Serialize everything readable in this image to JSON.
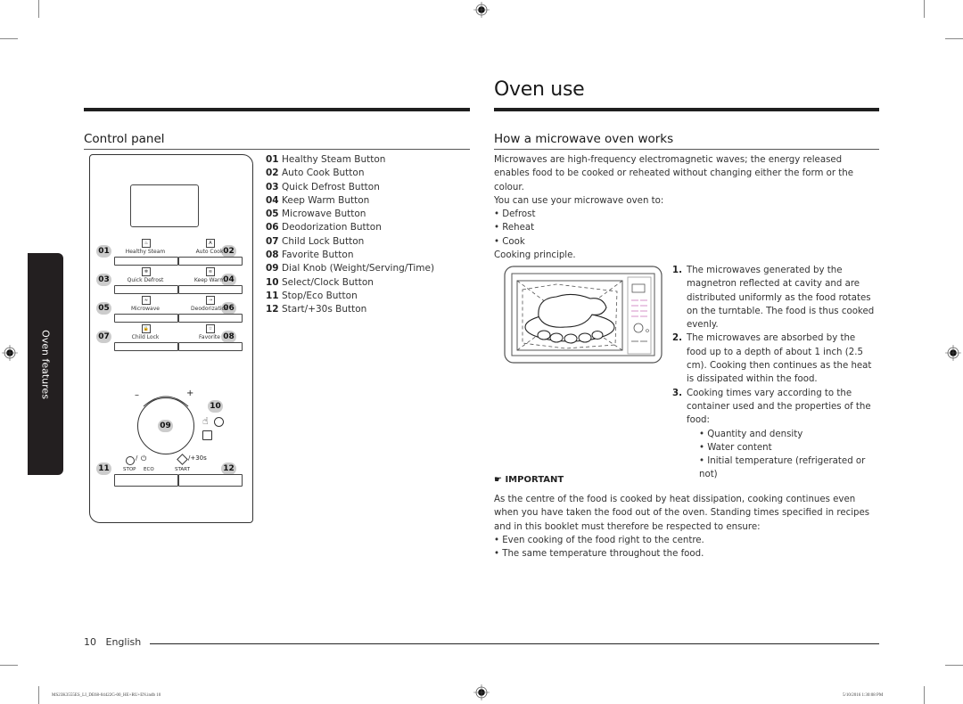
{
  "page": {
    "title": "Oven use",
    "side_tab": "Oven features",
    "footer": {
      "page_number": "10",
      "language": "English"
    },
    "print_info": {
      "file": "MS23K3555ES_LI_DE68-04422G-00_HE+RU+EN.indb   10",
      "timestamp": "5/10/2016   1:30:08 PM"
    }
  },
  "control_panel": {
    "heading": "Control panel",
    "legend": [
      {
        "num": "01",
        "label": "Healthy Steam Button"
      },
      {
        "num": "02",
        "label": "Auto Cook Button"
      },
      {
        "num": "03",
        "label": "Quick Defrost Button"
      },
      {
        "num": "04",
        "label": "Keep Warm Button"
      },
      {
        "num": "05",
        "label": "Microwave Button"
      },
      {
        "num": "06",
        "label": "Deodorization Button"
      },
      {
        "num": "07",
        "label": "Child Lock Button"
      },
      {
        "num": "08",
        "label": "Favorite Button"
      },
      {
        "num": "09",
        "label": "Dial Knob (Weight/Serving/Time)"
      },
      {
        "num": "10",
        "label": "Select/Clock Button"
      },
      {
        "num": "11",
        "label": "Stop/Eco Button"
      },
      {
        "num": "12",
        "label": "Start/+30s Button"
      }
    ],
    "diagram": {
      "buttons": [
        {
          "num": "01",
          "label": "Healthy Steam",
          "icon": "steam-icon"
        },
        {
          "num": "02",
          "label": "Auto Cook",
          "icon": "auto-icon"
        },
        {
          "num": "03",
          "label": "Quick Defrost",
          "icon": "defrost-icon"
        },
        {
          "num": "04",
          "label": "Keep Warm",
          "icon": "keep-warm-icon"
        },
        {
          "num": "05",
          "label": "Microwave",
          "icon": "microwave-icon"
        },
        {
          "num": "06",
          "label": "Deodorization",
          "icon": "deodorization-icon"
        },
        {
          "num": "07",
          "label": "Child Lock",
          "icon": "lock-icon"
        },
        {
          "num": "08",
          "label": "Favorite",
          "icon": "star-icon"
        }
      ],
      "dial": {
        "num": "09",
        "minus": "–",
        "plus": "+"
      },
      "select": {
        "num": "10"
      },
      "stop": {
        "num": "11",
        "stop_label": "STOP",
        "eco_label": "ECO",
        "slash": "/"
      },
      "start": {
        "num": "12",
        "start_label": "START",
        "extra": "/+30s"
      }
    }
  },
  "how_it_works": {
    "heading": "How a microwave oven works",
    "intro": "Microwaves are high-frequency electromagnetic waves; the energy released enables food to be cooked or reheated without changing either the form or the colour.",
    "uses_intro": "You can use your microwave oven to:",
    "uses": [
      "Defrost",
      "Reheat",
      "Cook"
    ],
    "principle_label": "Cooking principle.",
    "steps": [
      {
        "num": "1.",
        "text": "The microwaves generated by the magnetron reflected at cavity and are distributed uniformly as the food rotates on the turntable. The food is thus cooked evenly."
      },
      {
        "num": "2.",
        "text": "The microwaves are absorbed by the food up to a depth of about 1 inch (2.5 cm). Cooking then continues as the heat is dissipated within the food."
      },
      {
        "num": "3.",
        "text": "Cooking times vary according to the container used and the properties of the food:"
      }
    ],
    "factors": [
      "Quantity and density",
      "Water content",
      "Initial temperature (refrigerated or not)"
    ],
    "important": {
      "label": "IMPORTANT",
      "text": "As the centre of the food is cooked by heat dissipation, cooking continues even when you have taken the food out of the oven. Standing times specified in recipes and in this booklet must therefore be respected to ensure:",
      "bullets": [
        "Even cooking of the food right to the centre.",
        "The same temperature throughout the food."
      ]
    }
  }
}
